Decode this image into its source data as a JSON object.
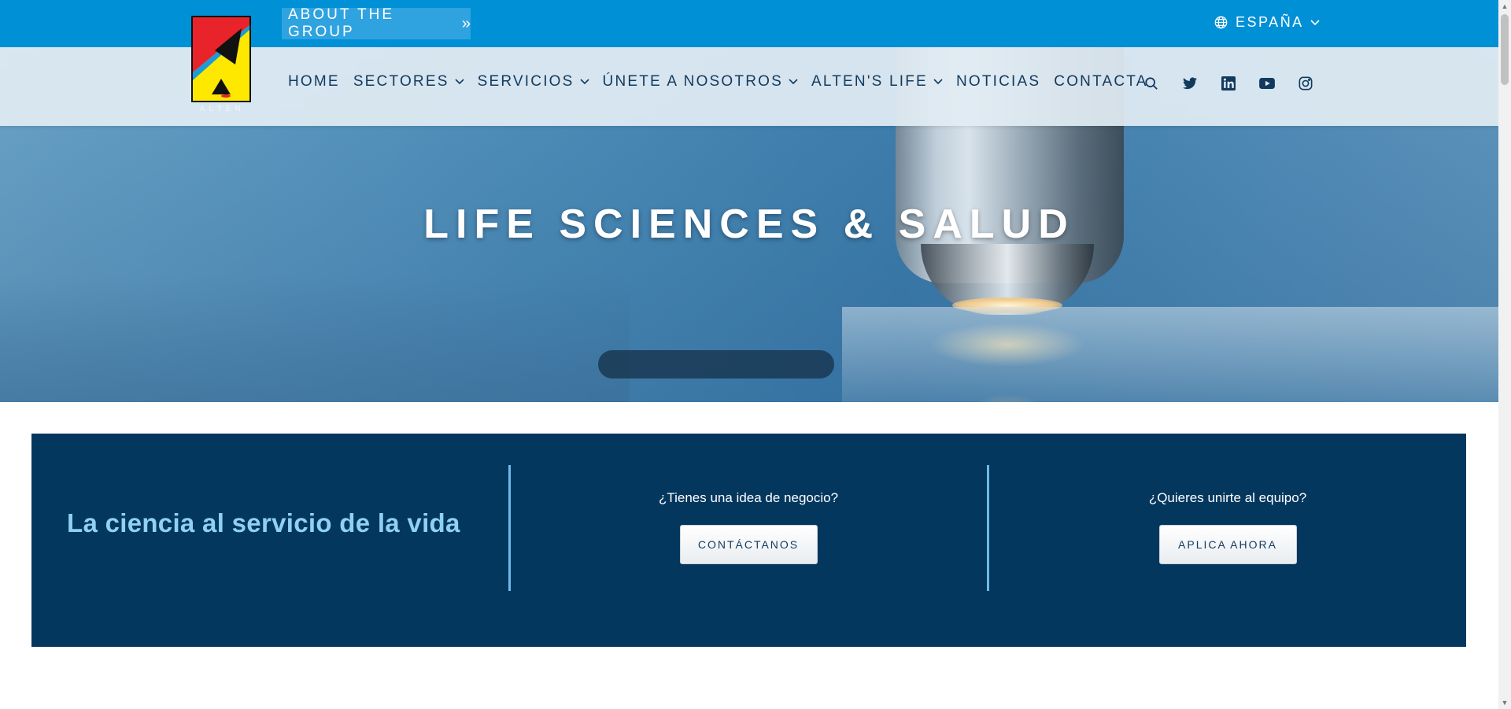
{
  "topbar": {
    "about_label": "ABOUT THE GROUP",
    "about_chevron": "»",
    "language": "ESPAÑA"
  },
  "logo": {
    "brand": "ALTEN"
  },
  "nav": {
    "items": [
      {
        "label": "HOME",
        "dropdown": false
      },
      {
        "label": "SECTORES",
        "dropdown": true
      },
      {
        "label": "SERVICIOS",
        "dropdown": true
      },
      {
        "label": "ÚNETE A NOSOTROS",
        "dropdown": true
      },
      {
        "label": "ALTEN'S LIFE",
        "dropdown": true
      },
      {
        "label": "NOTICIAS",
        "dropdown": false
      },
      {
        "label": "CONTACTA",
        "dropdown": false
      }
    ],
    "icons": [
      "search-icon",
      "twitter-icon",
      "linkedin-icon",
      "youtube-icon",
      "instagram-icon"
    ]
  },
  "hero": {
    "title": "LIFE SCIENCES & SALUD"
  },
  "cta": {
    "tagline": "La ciencia al servicio de la vida",
    "col1": {
      "question": "¿Tienes una idea de negocio?",
      "button": "CONTÁCTANOS"
    },
    "col2": {
      "question": "¿Quieres unirte al equipo?",
      "button": "APLICA AHORA"
    }
  },
  "colors": {
    "topbar": "#0090d5",
    "about_button": "#2fa3e0",
    "cta_background": "#04375e",
    "tagline": "#8fd0f3",
    "nav_text": "#123a5e"
  }
}
